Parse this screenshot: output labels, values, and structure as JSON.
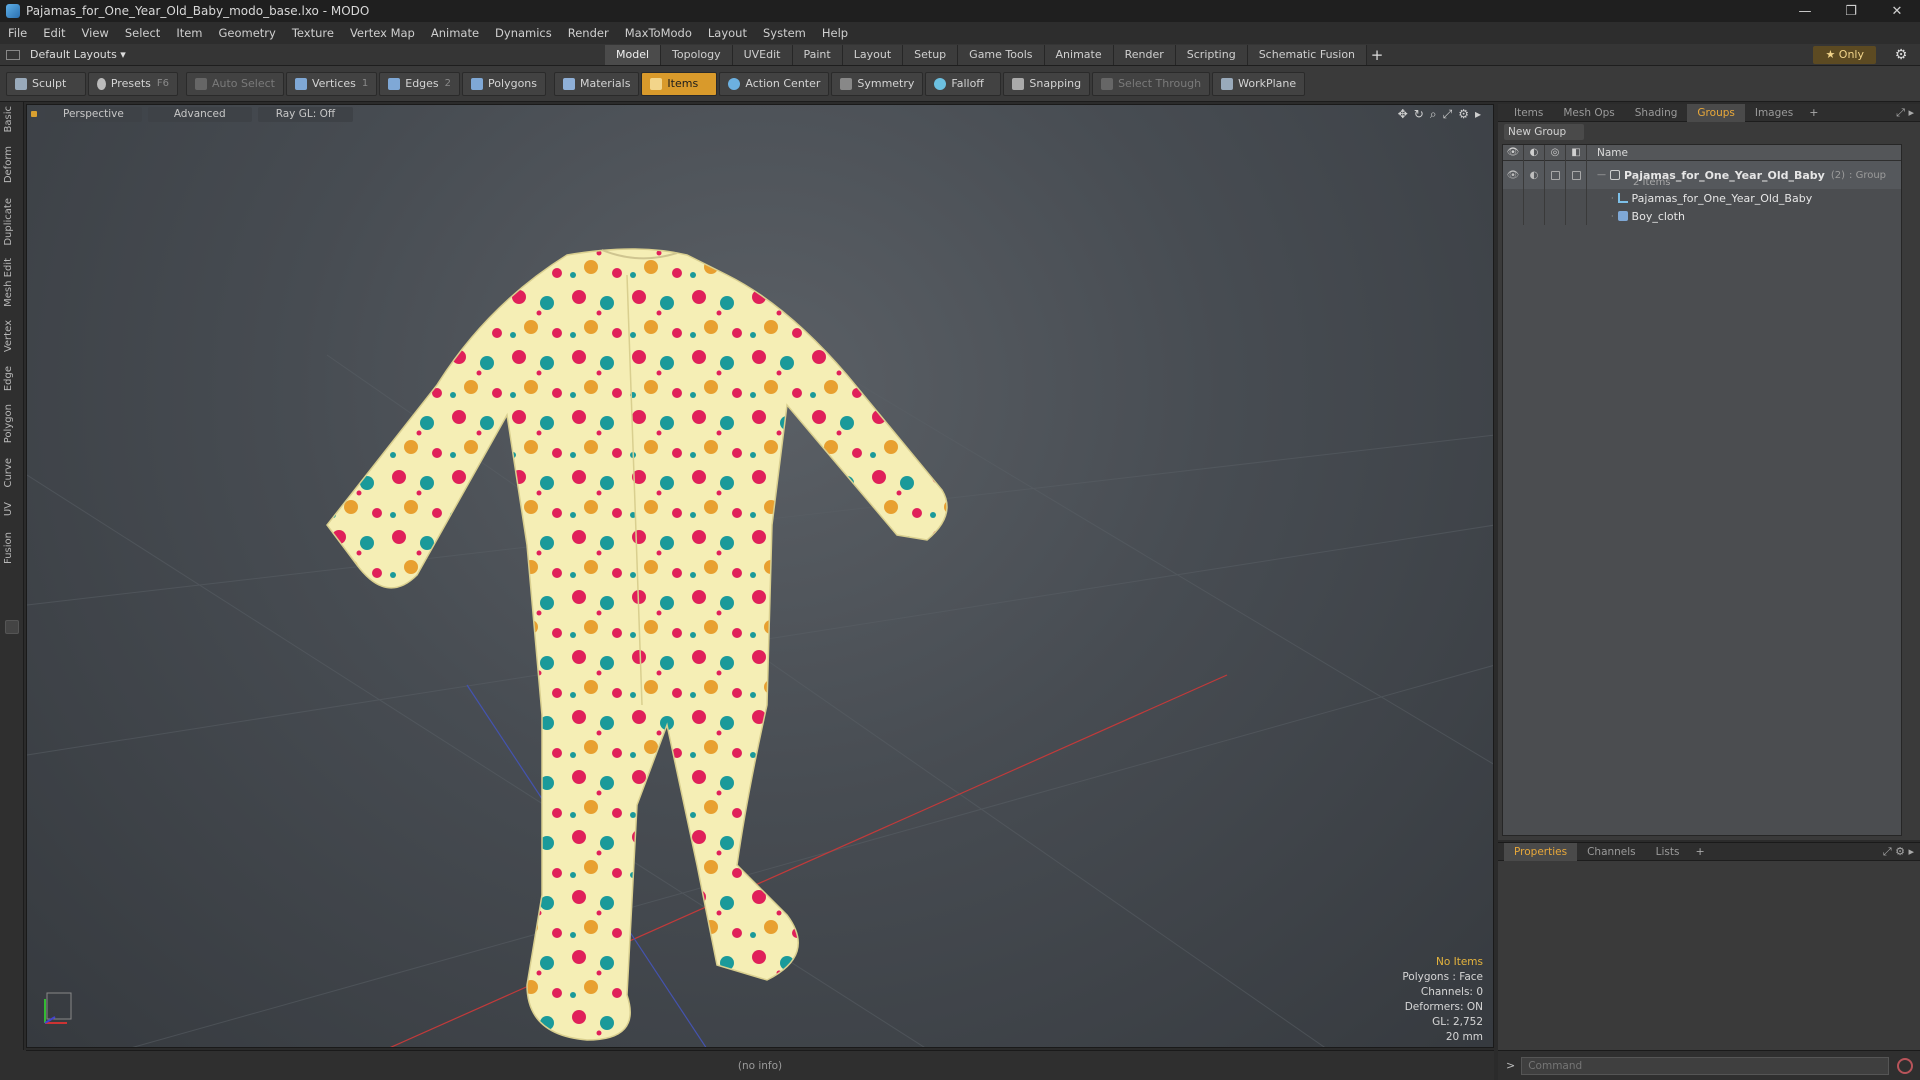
{
  "window": {
    "title": "Pajamas_for_One_Year_Old_Baby_modo_base.lxo - MODO",
    "controls": [
      "—",
      "❐",
      "✕"
    ]
  },
  "menu": [
    "File",
    "Edit",
    "View",
    "Select",
    "Item",
    "Geometry",
    "Texture",
    "Vertex Map",
    "Animate",
    "Dynamics",
    "Render",
    "MaxToModo",
    "Layout",
    "System",
    "Help"
  ],
  "layout_bar": {
    "layout_select": "Default Layouts ▾",
    "tabs": [
      "Model",
      "Topology",
      "UVEdit",
      "Paint",
      "Layout",
      "Setup",
      "Game Tools",
      "Animate",
      "Render",
      "Scripting",
      "Schematic Fusion"
    ],
    "active_tab": "Model",
    "add_tab": "+",
    "only_label": "★  Only",
    "gear_icon": "⚙"
  },
  "toolbar": {
    "sculpt": "Sculpt",
    "presets": "Presets",
    "presets_key": "F6",
    "auto_select": "Auto Select",
    "vertices": "Vertices",
    "vertices_key": "1",
    "edges": "Edges",
    "edges_key": "2",
    "polygons": "Polygons",
    "materials": "Materials",
    "items": "Items",
    "action_center": "Action Center",
    "symmetry": "Symmetry",
    "falloff": "Falloff",
    "snapping": "Snapping",
    "select_through": "Select Through",
    "workplane": "WorkPlane"
  },
  "left_tabs": [
    "Basic",
    "Deform",
    "Duplicate",
    "Mesh Edit",
    "Vertex",
    "Edge",
    "Polygon",
    "Curve",
    "UV",
    "Fusion"
  ],
  "viewport": {
    "view_mode": "Perspective",
    "shading": "Advanced",
    "raygl": "Ray GL: Off",
    "icons": [
      "✥",
      "↻",
      "⌕",
      "⤢",
      "⚙",
      "▸"
    ],
    "info": {
      "selection": "No Items",
      "polygons": "Polygons : Face",
      "channels": "Channels: 0",
      "deformers": "Deformers: ON",
      "gl": "GL: 2,752",
      "grid": "20 mm"
    },
    "colors": {
      "fabric": "#f5eeb5",
      "pink": "#e0205a",
      "teal": "#1a9a9a",
      "orange": "#e8a030"
    }
  },
  "groups_panel": {
    "tabs": [
      "Items",
      "Mesh Ops",
      "Shading",
      "Groups",
      "Images"
    ],
    "active_tab": "Groups",
    "new_group": "New Group",
    "name_header": "Name",
    "group": {
      "name": "Pajamas_for_One_Year_Old_Baby",
      "count": "(2)",
      "type": ": Group",
      "items_label": "2 Items",
      "children": [
        "Pajamas_for_One_Year_Old_Baby",
        "Boy_cloth"
      ]
    }
  },
  "properties_panel": {
    "tabs": [
      "Properties",
      "Channels",
      "Lists"
    ],
    "active_tab": "Properties"
  },
  "status": {
    "info": "(no info)",
    "command_placeholder": "Command",
    "prompt": ">"
  }
}
